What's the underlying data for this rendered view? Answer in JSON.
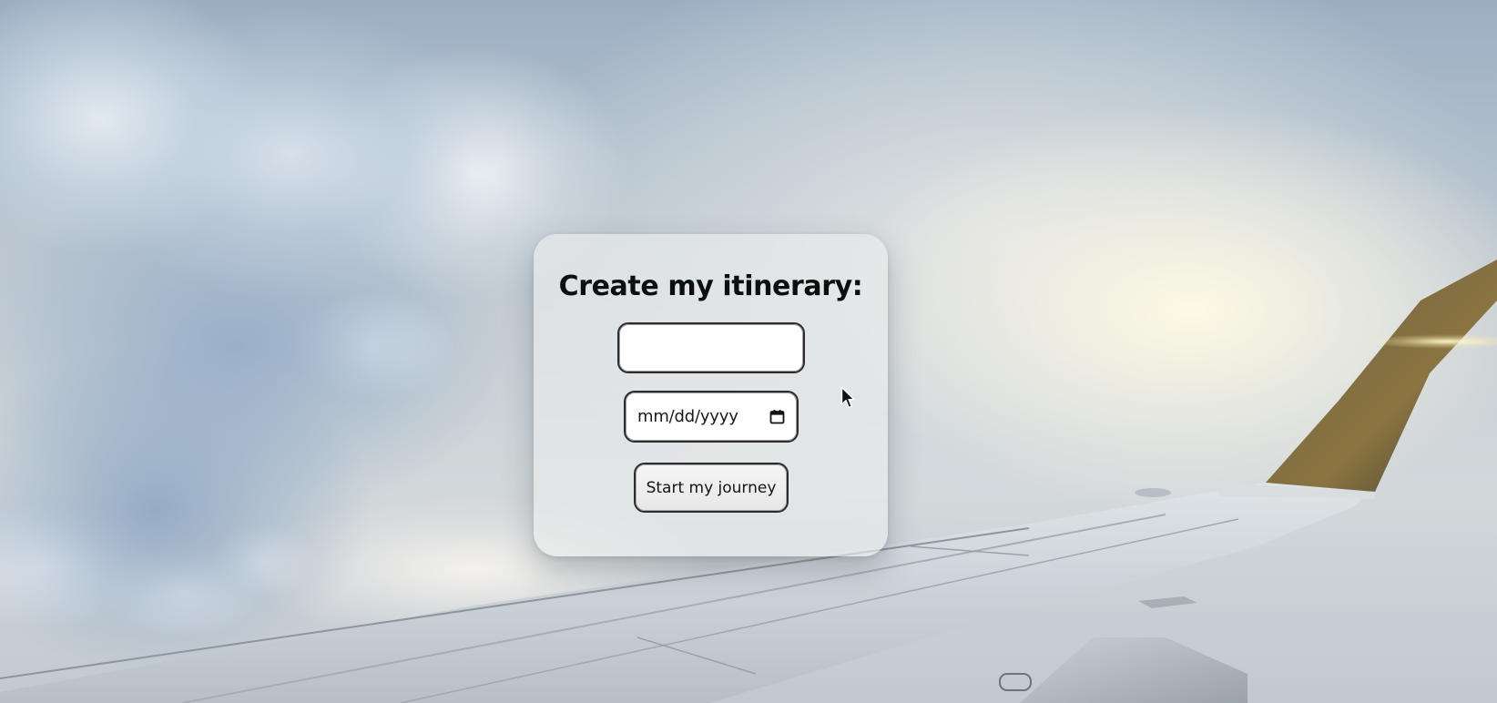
{
  "form": {
    "title": "Create my itinerary:",
    "destination_input": {
      "value": "",
      "placeholder": ""
    },
    "date_input": {
      "placeholder": "mm/dd/yyyy",
      "icon": "calendar-icon"
    },
    "submit_button": {
      "label": "Start my journey"
    }
  },
  "background": {
    "description_icon": "sky-clouds-airplane-wing-photo"
  },
  "cursor": {
    "icon": "mouse-pointer-icon"
  }
}
